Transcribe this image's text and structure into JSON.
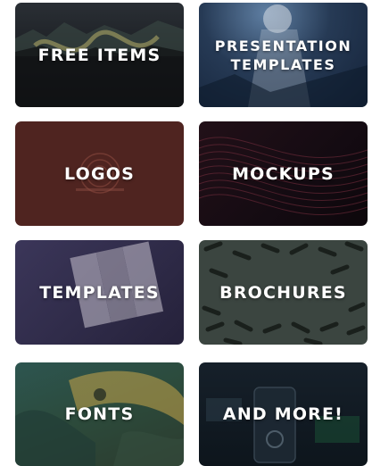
{
  "tiles": [
    {
      "label": "FREE ITEMS"
    },
    {
      "label": "PRESENTATION\nTEMPLATES"
    },
    {
      "label": "LOGOS"
    },
    {
      "label": "MOCKUPS"
    },
    {
      "label": "TEMPLATES"
    },
    {
      "label": "BROCHURES"
    },
    {
      "label": "FONTS"
    },
    {
      "label": "AND MORE!"
    }
  ]
}
